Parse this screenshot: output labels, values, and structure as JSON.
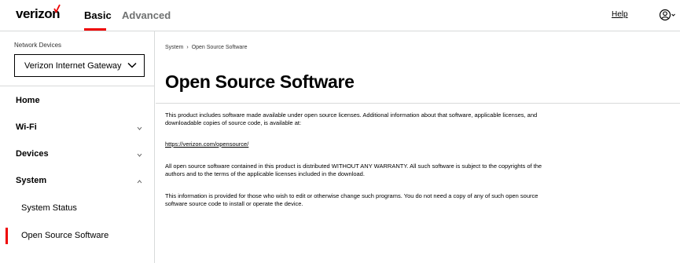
{
  "header": {
    "logo_text": "verizon",
    "tabs": [
      {
        "label": "Basic",
        "active": true
      },
      {
        "label": "Advanced",
        "active": false
      }
    ],
    "help_label": "Help",
    "user_icon": "user-circle-icon",
    "accent_color": "#ee0000"
  },
  "sidebar": {
    "network_devices_label": "Network Devices",
    "selected_device": "Verizon Internet Gateway",
    "nav": [
      {
        "label": "Home"
      },
      {
        "label": "Wi-Fi",
        "expanded": false
      },
      {
        "label": "Devices",
        "expanded": false
      },
      {
        "label": "System",
        "expanded": true
      }
    ],
    "system_sub": [
      {
        "label": "System Status",
        "active": false
      },
      {
        "label": "Open Source Software",
        "active": true
      }
    ]
  },
  "main": {
    "breadcrumb": {
      "parent": "System",
      "separator": "›",
      "current": "Open Source Software"
    },
    "title": "Open Source Software",
    "paragraph1": "This product includes software made available under open source licenses. Additional information about that software, applicable licenses, and downloadable copies of source code, is available at:",
    "link": "https://verizon.com/opensource/",
    "paragraph2": "All open source software contained in this product is distributed WITHOUT ANY WARRANTY. All such software is subject to the copyrights of the authors and to the terms of the applicable licenses included in the download.",
    "paragraph3": "This information is provided for those who wish to edit or otherwise change such programs. You do not need a copy of any of such open source software source code to install or operate the device."
  }
}
